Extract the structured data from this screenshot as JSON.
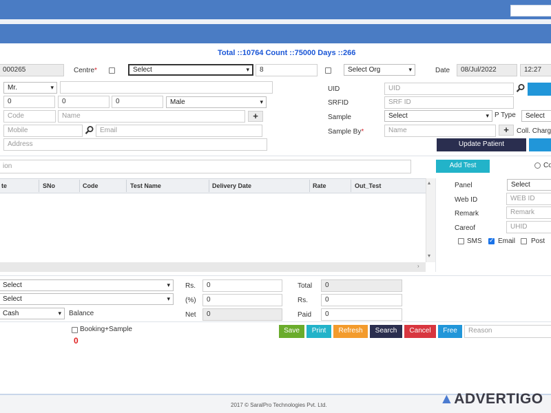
{
  "header": {
    "totals_text": "Total ::10764 Count ::75000 Days ::266"
  },
  "row1": {
    "id_value": "000265",
    "centre_label": "Centre",
    "required_mark": "*",
    "centre_select": "Select",
    "centre_number": "8",
    "org_select": "Select Org",
    "date_label": "Date",
    "date_value": "08/Jul/2022",
    "time_value": "12:27"
  },
  "patient": {
    "title_select": "Mr.",
    "age_years": "0",
    "age_months": "0",
    "age_days": "0",
    "gender_select": "Male",
    "code_placeholder": "Code",
    "name_placeholder": "Name",
    "mobile_placeholder": "Mobile",
    "email_placeholder": "Email",
    "address_placeholder": "Address",
    "plus": "+"
  },
  "right_panel": {
    "uid_label": "UID",
    "uid_placeholder": "UID",
    "srfid_label": "SRFID",
    "srfid_placeholder": "SRF ID",
    "sample_label": "Sample",
    "sample_select": "Select",
    "ptype_label": "P Type",
    "ptype_select": "Select",
    "sample_by_label": "Sample By",
    "sample_by_placeholder": "Name",
    "coll_charge_label": "Coll. Charge",
    "update_patient_button": "Update Patient"
  },
  "tests": {
    "search_placeholder": "ion",
    "add_test_button": "Add Test",
    "radio_label": "Co",
    "columns": [
      "te",
      "SNo",
      "Code",
      "Test Name",
      "Delivery Date",
      "Rate",
      "Out_Test"
    ]
  },
  "side_form": {
    "panel_label": "Panel",
    "panel_select": "Select",
    "webid_label": "Web ID",
    "webid_placeholder": "WEB ID",
    "remark_label": "Remark",
    "remark_placeholder": "Remark",
    "careof_label": "Careof",
    "careof_placeholder": "UHID",
    "sms_label": "SMS",
    "email_label": "Email",
    "post_label": "Post"
  },
  "payment": {
    "select1": "Select",
    "select2": "Select",
    "mode_select": "Cash",
    "balance_label": "Balance",
    "rs_label": "Rs.",
    "rs_value": "0",
    "pct_label": "(%)",
    "pct_value": "0",
    "net_label": "Net",
    "net_value": "0",
    "total_label": "Total",
    "total_value": "0",
    "rs2_label": "Rs.",
    "rs2_value": "0",
    "paid_label": "Paid",
    "paid_value": "0",
    "booking_label": "Booking+Sample",
    "booking_count": "0"
  },
  "actions": {
    "save": "Save",
    "print": "Print",
    "refresh": "Refresh",
    "search": "Search",
    "cancel": "Cancel",
    "free": "Free",
    "reason_placeholder": "Reason"
  },
  "footer": {
    "copyright": "2017 © SaralPro Technologies Pvt. Ltd.",
    "watermark": "ADVERTIGO"
  },
  "colors": {
    "header_blue": "#4a7cc4",
    "totals_blue": "#1a56d6",
    "teal": "#22b3c9",
    "dark_navy": "#2a2e4f",
    "save_green": "#6aac2c",
    "refresh_orange": "#f39b2c",
    "cancel_red": "#d8363f",
    "free_blue": "#2196d9"
  }
}
